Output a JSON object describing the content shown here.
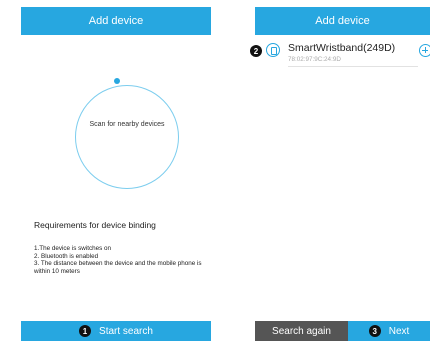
{
  "left_screen": {
    "header_title": "Add device",
    "scan_label": "Scan for nearby devices",
    "requirements": {
      "title": "Requirements for device binding",
      "items": [
        "1.The device is switches on",
        "2. Bluetooth is enabled",
        "3. The distance between the device and the mobile phone is within 10 meters"
      ]
    },
    "start_button": {
      "step": "1",
      "label": "Start search"
    }
  },
  "right_screen": {
    "header_title": "Add device",
    "device": {
      "step": "2",
      "name": "SmartWristband(249D)",
      "mac": "78:02:97:9C:24:9D",
      "icon": "wristband-icon",
      "action_icon": "add-circle-icon"
    },
    "search_again_label": "Search again",
    "next_button": {
      "step": "3",
      "label": "Next"
    }
  },
  "colors": {
    "accent": "#27a7e0",
    "secondary_button": "#555555",
    "badge": "#111111"
  }
}
